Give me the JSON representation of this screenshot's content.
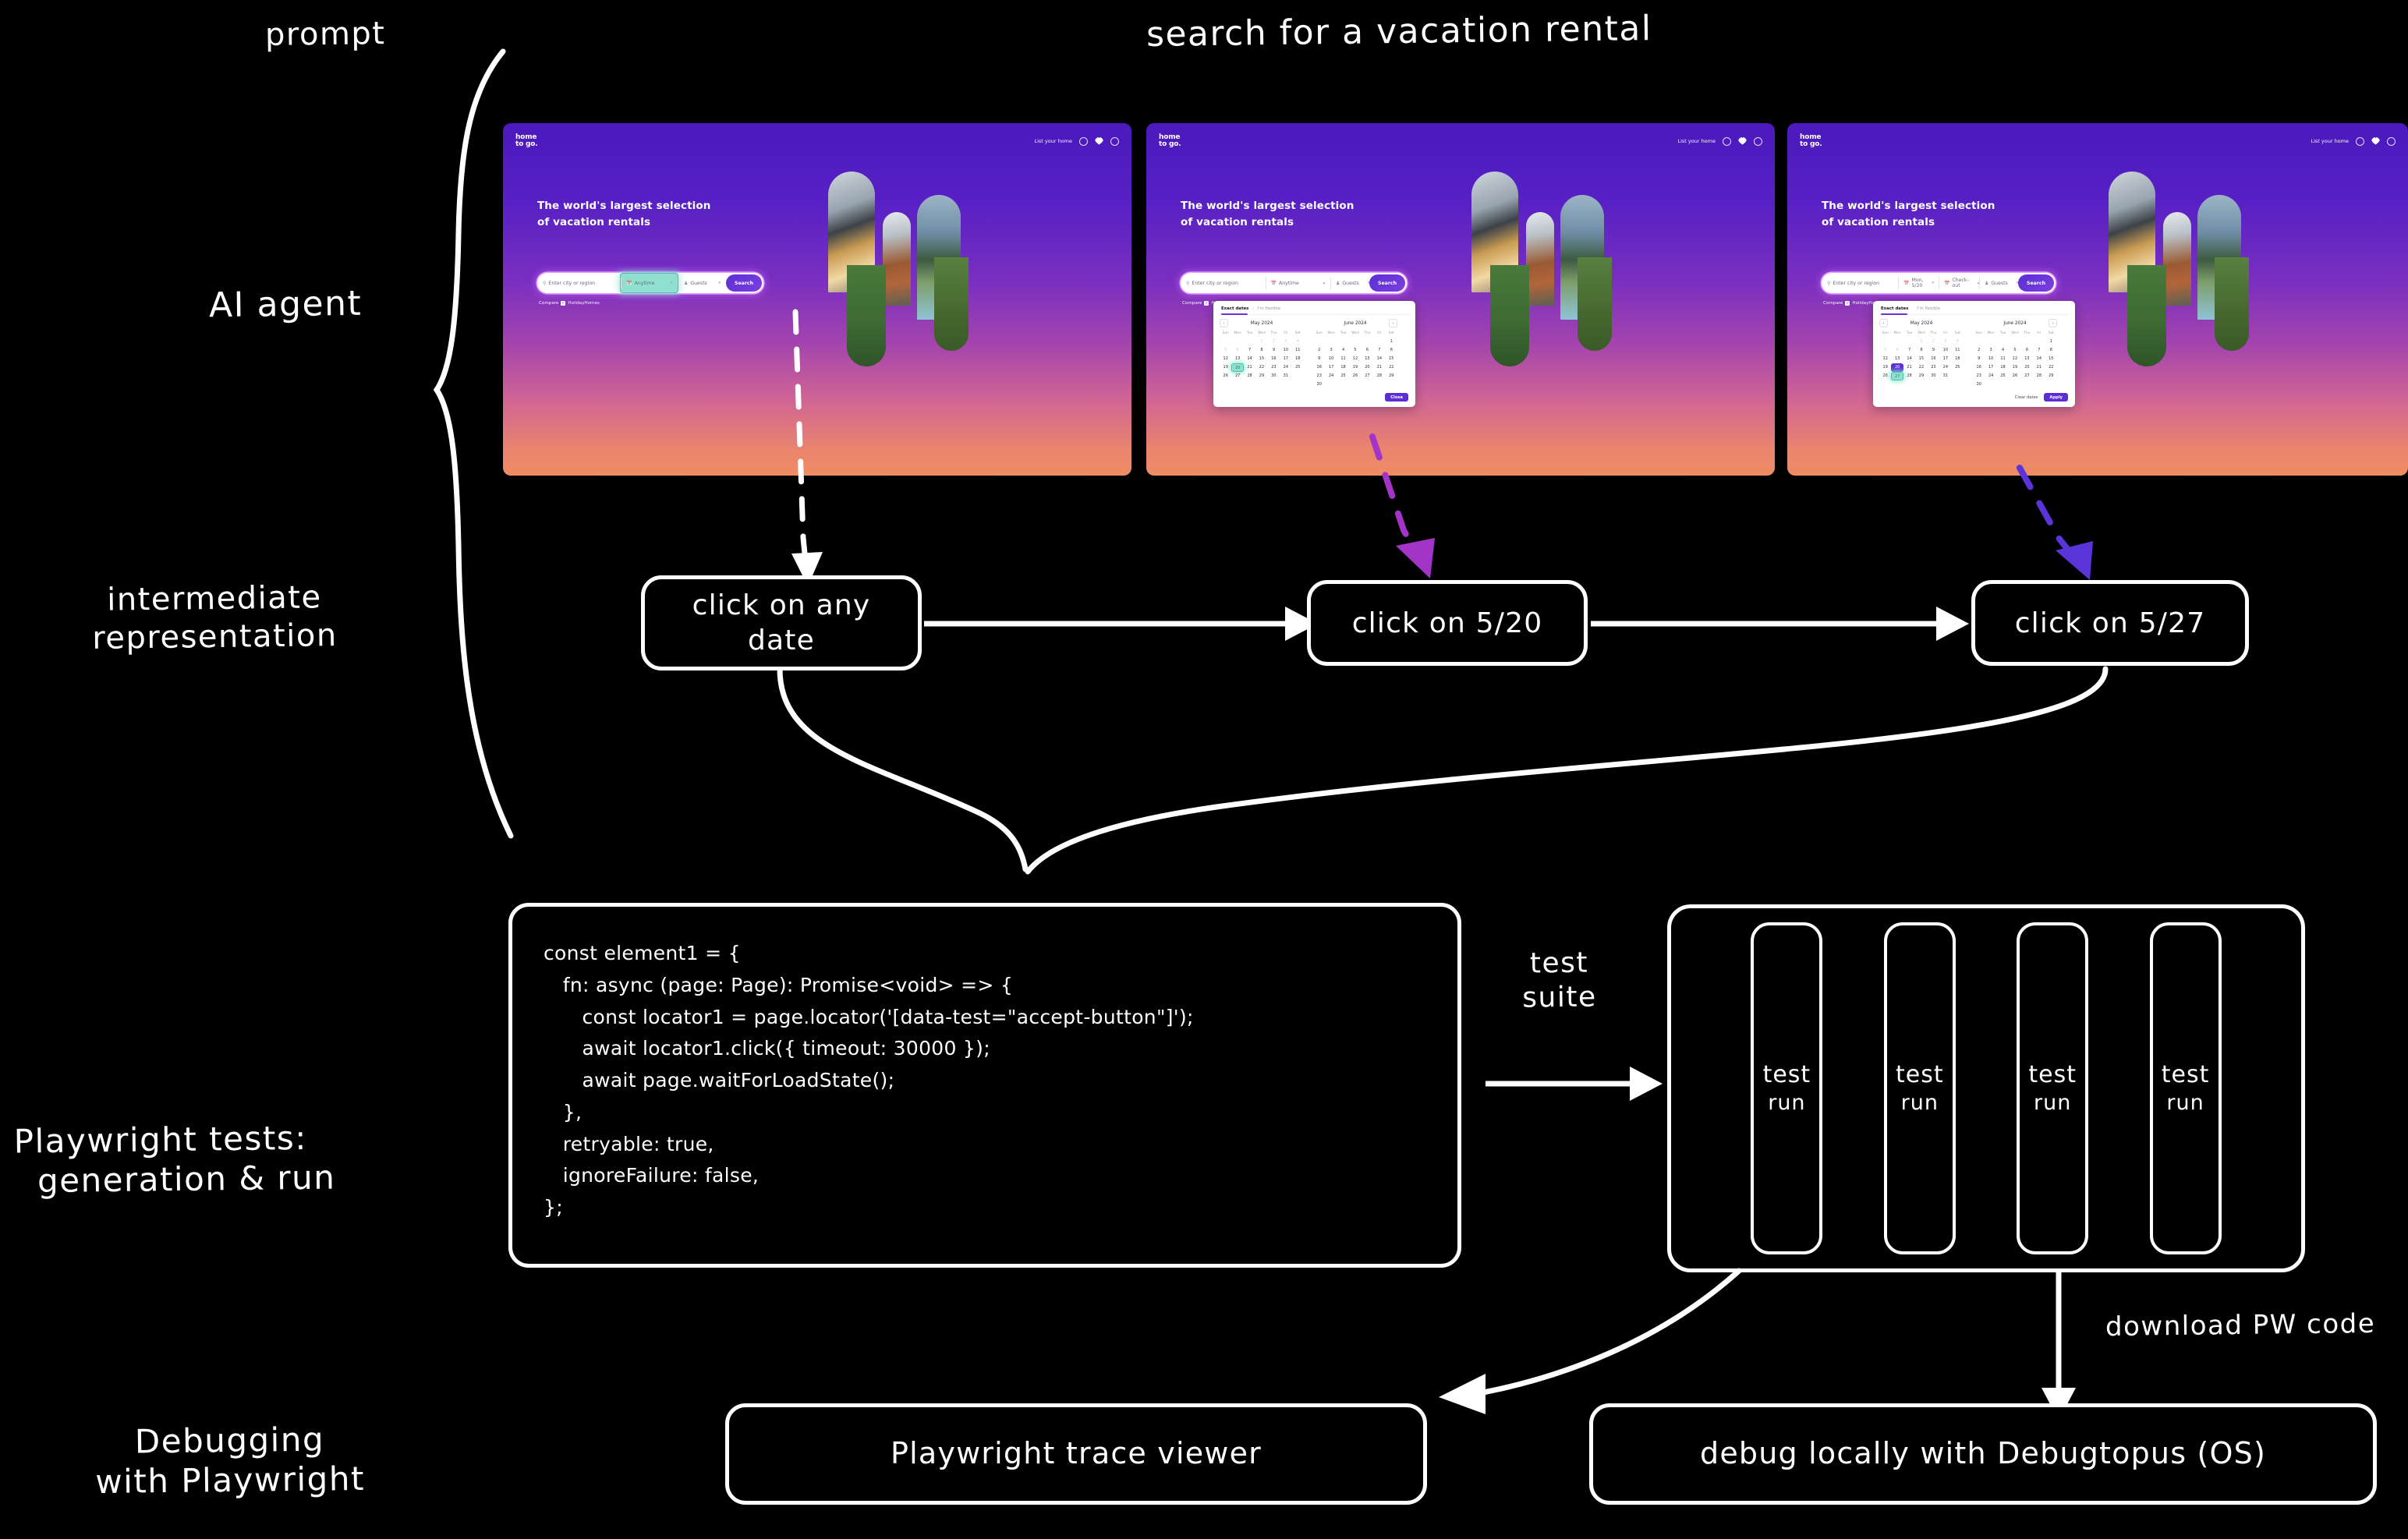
{
  "diagram": {
    "title": "search for a vacation rental",
    "stage_labels": {
      "prompt": "prompt",
      "ai_agent": "AI agent",
      "intermediate_representation": "intermediate\nrepresentation",
      "playwright_tests": "Playwright tests:\n  generation & run",
      "debugging": "Debugging\nwith Playwright"
    },
    "edge_labels": {
      "test_suite": "test\nsuite",
      "download_pw_code": "download PW code"
    }
  },
  "steps": [
    {
      "label": "click on any\ndate"
    },
    {
      "label": "click on 5/20"
    },
    {
      "label": "click on 5/27"
    }
  ],
  "browser": {
    "logo_line1": "home",
    "logo_line2": "to go.",
    "nav_link": "List your home",
    "nav_icons": [
      "globe-icon",
      "heart-icon",
      "account-icon"
    ],
    "hero_line1": "The world's largest selection",
    "hero_line2": "of vacation rentals",
    "compare_label": "Compare",
    "compare_brand": "HolidayHomes",
    "compare_checked": "✓",
    "search_button": "Search",
    "fields": {
      "location_placeholder": "Enter city or region",
      "dates_anytime": "Anytime",
      "dates_checkin": "Mon, 5/20",
      "dates_checkout": "Check-out",
      "guests": "Guests"
    }
  },
  "calendar": {
    "tabs": [
      "Exact dates",
      "I'm flexible"
    ],
    "dow": [
      "Sun",
      "Mon",
      "Tue",
      "Wed",
      "Thu",
      "Fri",
      "Sat"
    ],
    "months": [
      {
        "title": "May 2024",
        "weeks": [
          [
            "",
            "",
            "",
            "1",
            "2",
            "3",
            "4"
          ],
          [
            "5",
            "6",
            "7",
            "8",
            "9",
            "10",
            "11"
          ],
          [
            "12",
            "13",
            "14",
            "15",
            "16",
            "17",
            "18"
          ],
          [
            "19",
            "20",
            "21",
            "22",
            "23",
            "24",
            "25"
          ],
          [
            "26",
            "27",
            "28",
            "29",
            "30",
            "31",
            ""
          ]
        ],
        "dim": [
          "1",
          "2",
          "3",
          "4",
          "5",
          "6"
        ]
      },
      {
        "title": "June 2024",
        "weeks": [
          [
            "",
            "",
            "",
            "",
            "",
            "",
            "1"
          ],
          [
            "2",
            "3",
            "4",
            "5",
            "6",
            "7",
            "8"
          ],
          [
            "9",
            "10",
            "11",
            "12",
            "13",
            "14",
            "15"
          ],
          [
            "16",
            "17",
            "18",
            "19",
            "20",
            "21",
            "22"
          ],
          [
            "23",
            "24",
            "25",
            "26",
            "27",
            "28",
            "29"
          ],
          [
            "30",
            "",
            "",
            "",
            "",
            "",
            ""
          ]
        ],
        "dim": []
      }
    ],
    "buttons": {
      "close": "Close",
      "clear_dates": "Clear dates",
      "apply": "Apply"
    },
    "selection_step2": {
      "teal": "20"
    },
    "selection_step3": {
      "purple": "20",
      "teal": "27"
    }
  },
  "code": {
    "text": "const element1 = {\n   fn: async (page: Page): Promise<void> => {\n      const locator1 = page.locator('[data-test=\"accept-button\"]');\n      await locator1.click({ timeout: 30000 });\n      await page.waitForLoadState();\n   },\n   retryable: true,\n   ignoreFailure: false,\n};"
  },
  "test_runs": [
    {
      "line1": "test",
      "line2": "run"
    },
    {
      "line1": "test",
      "line2": "run"
    },
    {
      "line1": "test",
      "line2": "run"
    },
    {
      "line1": "test",
      "line2": "run"
    }
  ],
  "debug_boxes": [
    {
      "label": "Playwright trace viewer"
    },
    {
      "label": "debug locally with Debugtopus (OS)"
    }
  ],
  "colors": {
    "background": "#000000",
    "stroke": "#ffffff",
    "brand_purple": "#5b2fd4",
    "highlight_teal": "#8fe0d0",
    "arrow_magenta": "#a234c7",
    "arrow_indigo": "#5a34d8"
  }
}
